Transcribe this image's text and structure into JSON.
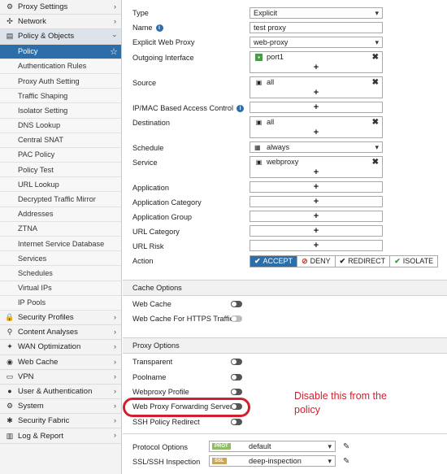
{
  "sidebar": {
    "top_before": [
      {
        "label": "Proxy Settings",
        "icon": "gear-icon",
        "glyph": "⚙"
      },
      {
        "label": "Network",
        "icon": "network-icon",
        "glyph": "✣"
      }
    ],
    "open_group": {
      "label": "Policy & Objects",
      "icon": "policy-icon",
      "glyph": "▤"
    },
    "sub_items": [
      "Policy",
      "Authentication Rules",
      "Proxy Auth Setting",
      "Traffic Shaping",
      "Isolator Setting",
      "DNS Lookup",
      "Central SNAT",
      "PAC Policy",
      "Policy Test",
      "URL Lookup",
      "Decrypted Traffic Mirror",
      "Addresses",
      "ZTNA",
      "Internet Service Database",
      "Services",
      "Schedules",
      "Virtual IPs",
      "IP Pools"
    ],
    "active_sub_index": 0,
    "top_after": [
      {
        "label": "Security Profiles",
        "icon": "lock-icon",
        "glyph": "🔒"
      },
      {
        "label": "Content Analyses",
        "icon": "content-icon",
        "glyph": "⚲"
      },
      {
        "label": "WAN Optimization",
        "icon": "wan-icon",
        "glyph": "✦"
      },
      {
        "label": "Web Cache",
        "icon": "cache-icon",
        "glyph": "◉"
      },
      {
        "label": "VPN",
        "icon": "monitor-icon",
        "glyph": "▭"
      },
      {
        "label": "User & Authentication",
        "icon": "user-icon",
        "glyph": "●"
      },
      {
        "label": "System",
        "icon": "gear-icon",
        "glyph": "⚙"
      },
      {
        "label": "Security Fabric",
        "icon": "fabric-icon",
        "glyph": "✱"
      },
      {
        "label": "Log & Report",
        "icon": "chart-icon",
        "glyph": "▥"
      }
    ]
  },
  "form": {
    "type": {
      "label": "Type",
      "value": "Explicit"
    },
    "name": {
      "label": "Name",
      "value": "test proxy"
    },
    "explicit_proxy": {
      "label": "Explicit Web Proxy",
      "value": "web-proxy"
    },
    "outgoing": {
      "label": "Outgoing Interface",
      "value": "port1"
    },
    "source": {
      "label": "Source",
      "value": "all"
    },
    "ipmac": {
      "label": "IP/MAC Based Access Control"
    },
    "destination": {
      "label": "Destination",
      "value": "all"
    },
    "schedule": {
      "label": "Schedule",
      "value": "always"
    },
    "service": {
      "label": "Service",
      "value": "webproxy"
    },
    "application": {
      "label": "Application"
    },
    "app_category": {
      "label": "Application Category"
    },
    "app_group": {
      "label": "Application Group"
    },
    "url_category": {
      "label": "URL Category"
    },
    "url_risk": {
      "label": "URL Risk"
    },
    "action": {
      "label": "Action",
      "options": [
        {
          "icon": "✔",
          "label": "ACCEPT"
        },
        {
          "icon": "⊘",
          "label": "DENY"
        },
        {
          "icon": "✔",
          "label": "REDIRECT"
        },
        {
          "icon": "✔",
          "label": "ISOLATE"
        }
      ],
      "selected": "ACCEPT"
    },
    "plus": "+"
  },
  "cache_options": {
    "title": "Cache Options",
    "items": [
      {
        "label": "Web Cache",
        "enabled": false
      },
      {
        "label": "Web Cache For HTTPS Traffic",
        "enabled": false
      }
    ]
  },
  "proxy_options": {
    "title": "Proxy Options",
    "items": [
      {
        "label": "Transparent",
        "enabled": false
      },
      {
        "label": "Poolname",
        "enabled": false
      },
      {
        "label": "Webproxy Profile",
        "enabled": false
      },
      {
        "label": "Web Proxy Forwarding Server",
        "enabled": false
      },
      {
        "label": "SSH Policy Redirect",
        "enabled": false
      }
    ]
  },
  "annotation": "Disable this from the policy",
  "profiles": {
    "protocol": {
      "label": "Protocol Options",
      "tag": "PROT",
      "value": "default"
    },
    "ssl": {
      "label": "SSL/SSH Inspection",
      "tag": "SSL",
      "value": "deep-inspection"
    }
  },
  "colors": {
    "accent": "#2d6da8",
    "annotation": "#d0202e",
    "prot_tag": "#8fbf62",
    "ssl_tag": "#c9a55c"
  }
}
